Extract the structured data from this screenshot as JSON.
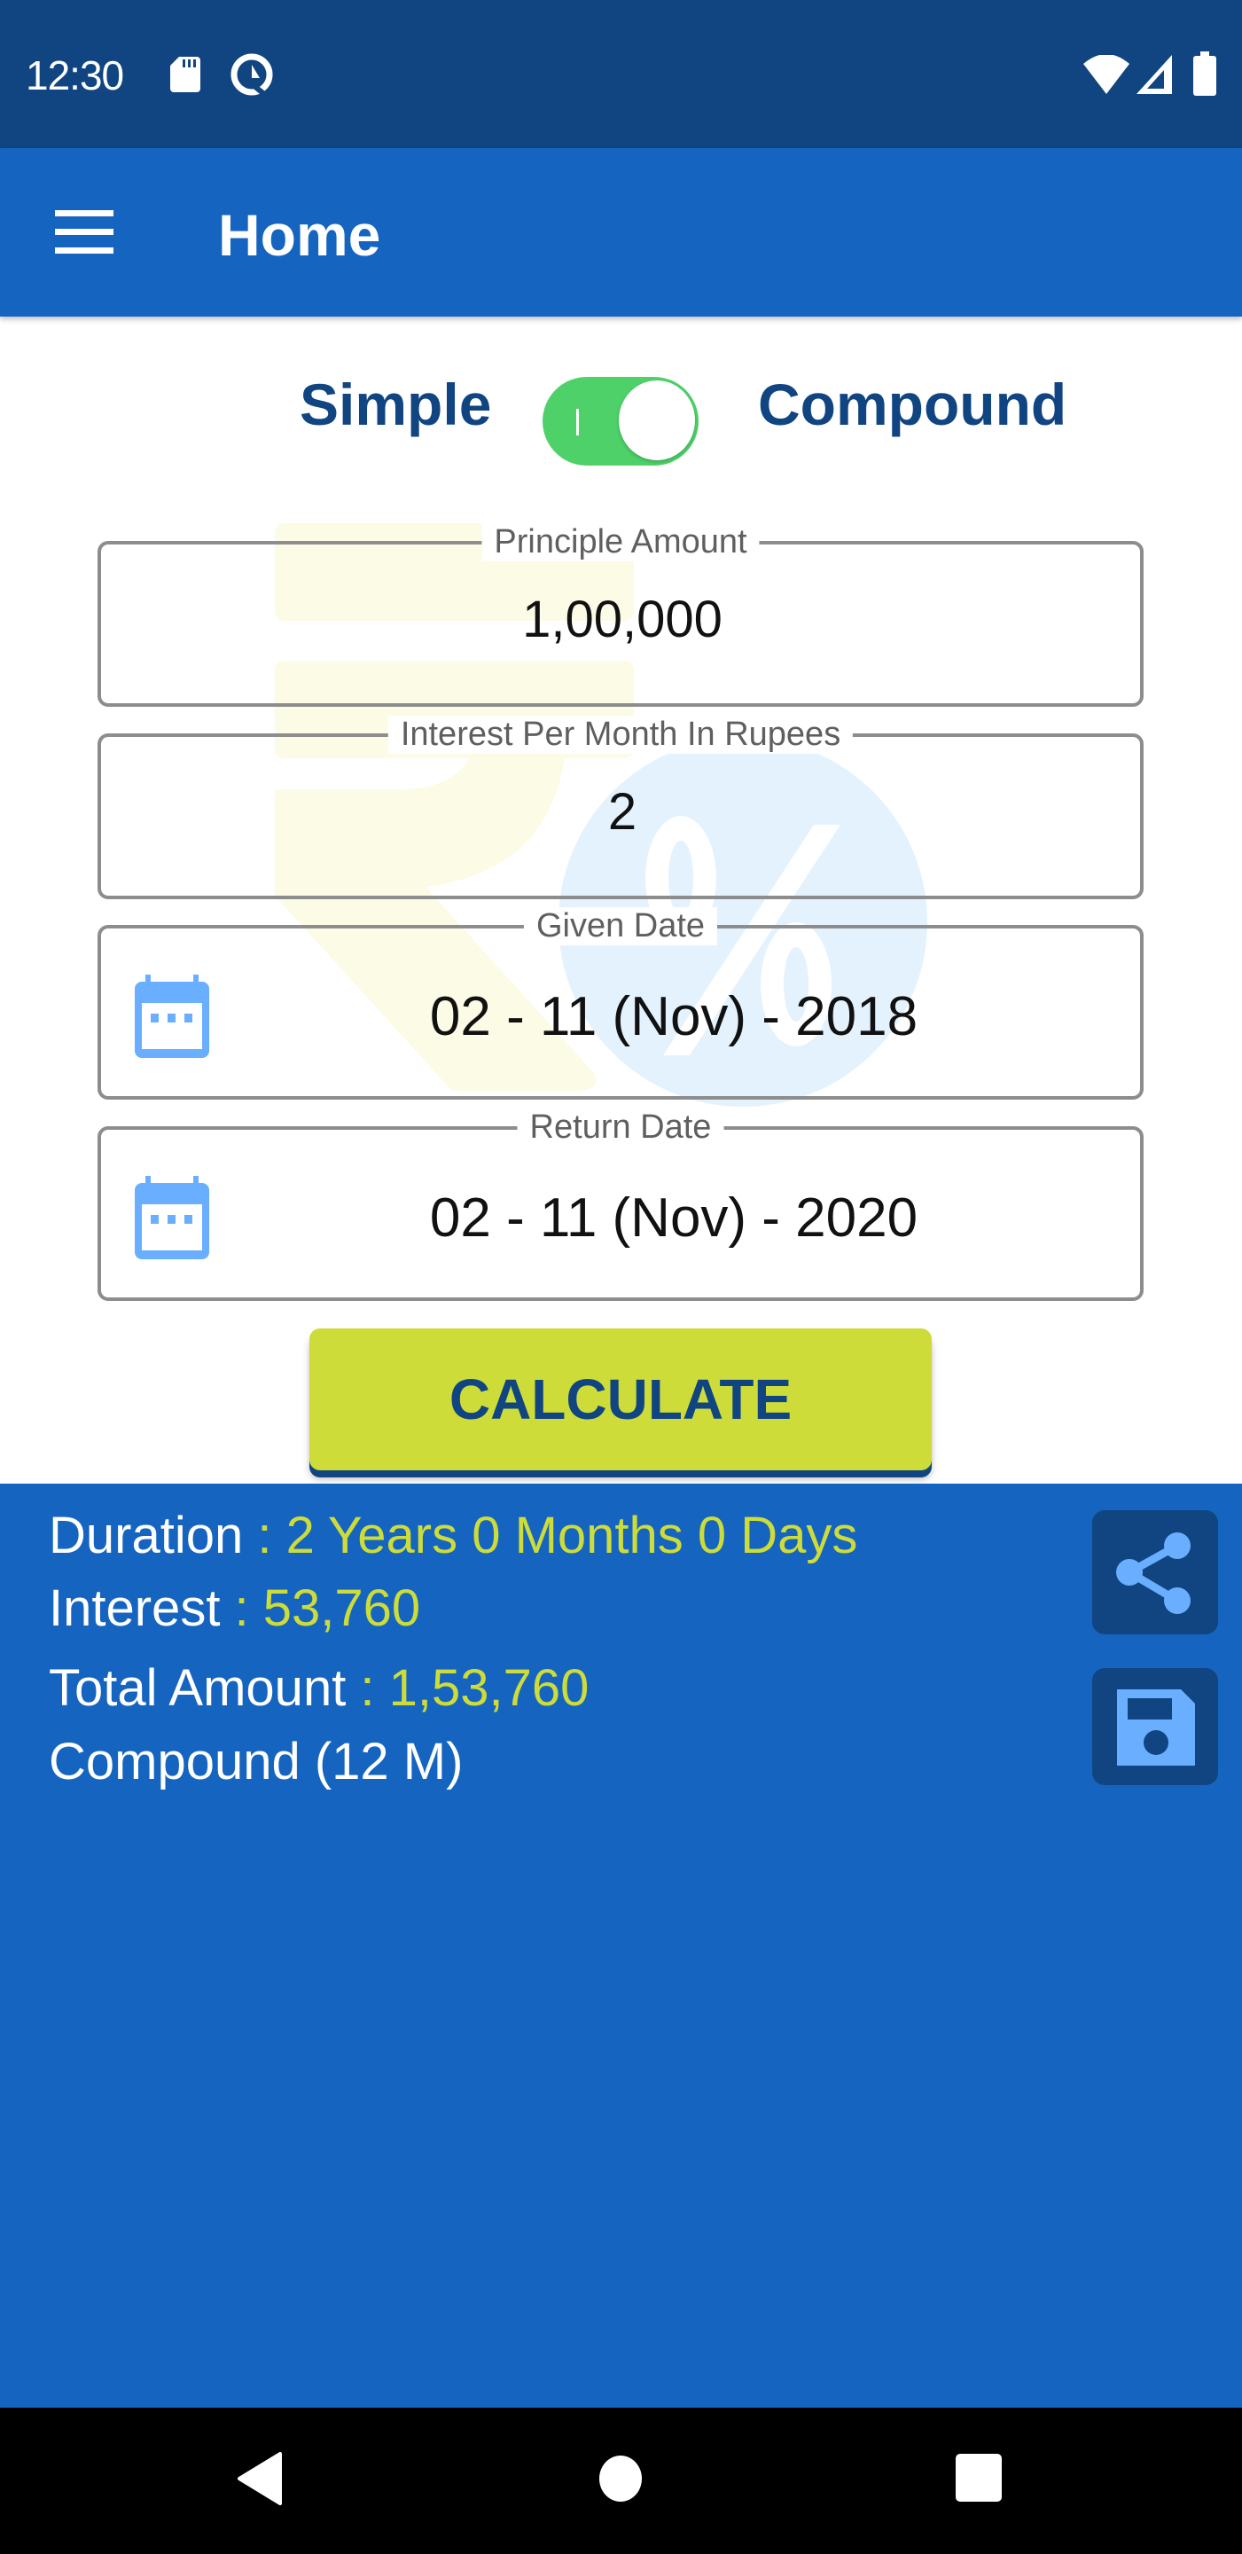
{
  "status_bar": {
    "time": "12:30",
    "left_icons": [
      "sd-card-icon",
      "data-saver-icon"
    ],
    "right_icons": [
      "wifi-icon",
      "cellular-signal-icon",
      "battery-icon"
    ]
  },
  "app_bar": {
    "menu_icon": "hamburger-menu-icon",
    "title": "Home"
  },
  "mode_toggle": {
    "left_label": "Simple",
    "right_label": "Compound",
    "state": "on",
    "selected": "Compound",
    "on_color": "#4fd16a"
  },
  "form": {
    "principle": {
      "label": "Principle Amount",
      "value": "1,00,000"
    },
    "interest": {
      "label": "Interest Per Month In Rupees",
      "value": "2"
    },
    "given_date": {
      "label": "Given Date",
      "value": "02 - 11 (Nov) - 2018",
      "icon": "calendar-icon"
    },
    "return_date": {
      "label": "Return Date",
      "value": "02 - 11 (Nov) - 2020",
      "icon": "calendar-icon"
    }
  },
  "calculate_button": {
    "label": "CALCULATE",
    "color": "#cddc39"
  },
  "results": {
    "duration": {
      "label": "Duration",
      "separator": " : ",
      "value": "2 Years 0 Months 0 Days"
    },
    "interest": {
      "label": "Interest",
      "separator": " : ",
      "value": "53,760"
    },
    "total": {
      "label": "Total Amount",
      "separator": " : ",
      "value": "1,53,760"
    },
    "mode_note": "Compound (12 M)",
    "share_icon": "share-icon",
    "save_icon": "save-icon"
  },
  "nav_bar": {
    "buttons": [
      "back-icon",
      "home-icon",
      "recents-icon"
    ]
  },
  "colors": {
    "status_bar": "#104581",
    "primary": "#1565c0",
    "accent": "#cddc39",
    "dark_blue": "#104581",
    "icon_blue": "#6aaeff"
  }
}
